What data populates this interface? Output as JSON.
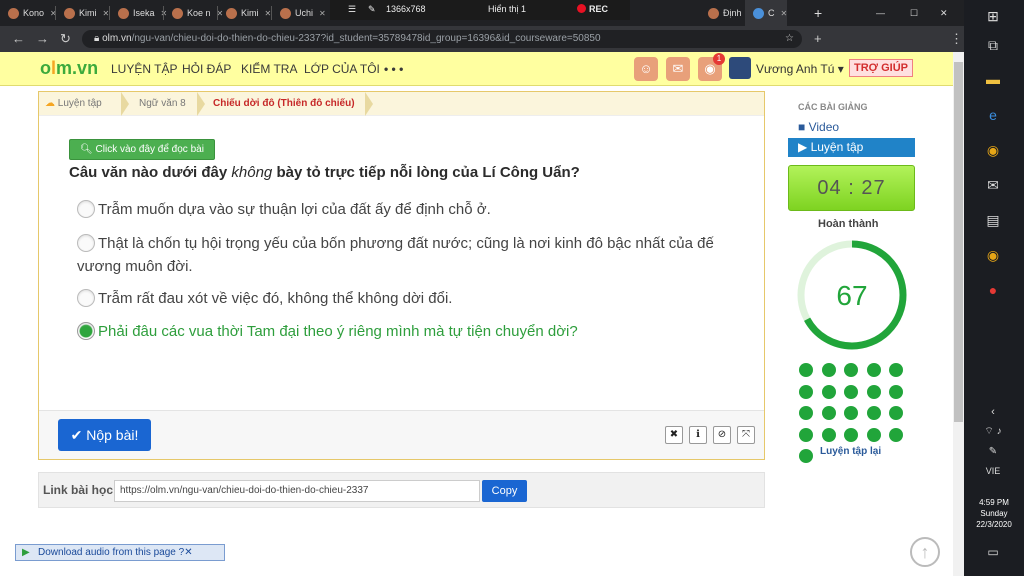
{
  "browser": {
    "tabs": [
      {
        "label": "Kono",
        "icon": "tab-favicon"
      },
      {
        "label": "Kimi",
        "icon": "tab-favicon"
      },
      {
        "label": "Iseka",
        "icon": "tab-favicon"
      },
      {
        "label": "Koe n",
        "icon": "tab-favicon"
      },
      {
        "label": "Kimi",
        "icon": "tab-favicon"
      },
      {
        "label": "Uchi",
        "icon": "tab-favicon"
      },
      {
        "label": "Định",
        "icon": "tab-favicon"
      },
      {
        "label": "C",
        "icon": "tab-favicon"
      }
    ],
    "recorder": {
      "resolution": "1366x768",
      "display": "Hiển thị 1",
      "rec": "REC"
    },
    "url_host": "olm.vn",
    "url_path": "/ngu-van/chieu-doi-do-thien-do-chieu-2337?id_student=35789478id_group=16396&id_courseware=50850"
  },
  "header": {
    "logo": "olm.vn",
    "nav": [
      "LUYỆN TẬP",
      "HỎI ĐÁP",
      "KIỂM TRA",
      "LỚP CỦA TÔI",
      "• • •"
    ],
    "notification_count": "1",
    "user_name": "Vương Anh Tú",
    "help": "TRỢ GIÚP"
  },
  "breadcrumbs": [
    "Luyện tập",
    "Ngữ văn 8",
    "Chiếu dời đô (Thiên đô chiếu)"
  ],
  "lesson": {
    "read_button": "Click vào đây để đọc bài",
    "question_pre": "Câu văn nào dưới đây ",
    "question_em": "không",
    "question_post": " bày tỏ trực tiếp nỗi lòng của Lí Công Uẩn?",
    "options": [
      {
        "text": "Trẫm muốn dựa vào sự thuận lợi của đất ấy để định chỗ ở.",
        "selected": false
      },
      {
        "text": "Thật là chốn tụ hội trọng yếu của bốn phương đất nước; cũng là nơi kinh đô bậc nhất của đế vương muôn đời.",
        "selected": false
      },
      {
        "text": "Trẫm rất đau xót về việc đó, không thể không dời đổi.",
        "selected": false
      },
      {
        "text": "Phải đâu các vua thời Tam đại theo ý riêng mình mà tự tiện chuyển dời?",
        "selected": true
      }
    ],
    "submit": "✔ Nộp bài!",
    "footer_icons": [
      "close-icon",
      "info-icon",
      "ban-icon",
      "fullscreen-icon"
    ]
  },
  "link": {
    "label": "Link bài học:",
    "url": "https://olm.vn/ngu-van/chieu-doi-do-thien-do-chieu-2337",
    "copy": "Copy"
  },
  "sidebar": {
    "heading": "CÁC BÀI GIẢNG",
    "items": [
      {
        "label": "Video",
        "icon": "video-icon",
        "active": false
      },
      {
        "label": "Luyện tập",
        "icon": "play-icon",
        "active": true
      }
    ],
    "timer": "04 : 27",
    "done_label": "Hoàn thành",
    "score": "67",
    "progress_fraction": 0.67,
    "dot_count": 21,
    "retry": "Luyện tập lại"
  },
  "audio_bar": {
    "label": "Download audio from this page"
  },
  "taskbar": {
    "lang": "VIE",
    "time": "4:59 PM",
    "day": "Sunday",
    "date": "22/3/2020"
  },
  "colors": {
    "brand_green": "#3caa3c",
    "accent_blue": "#1a66d2",
    "header_bg": "#ffffa0",
    "progress": "#21a53a"
  }
}
